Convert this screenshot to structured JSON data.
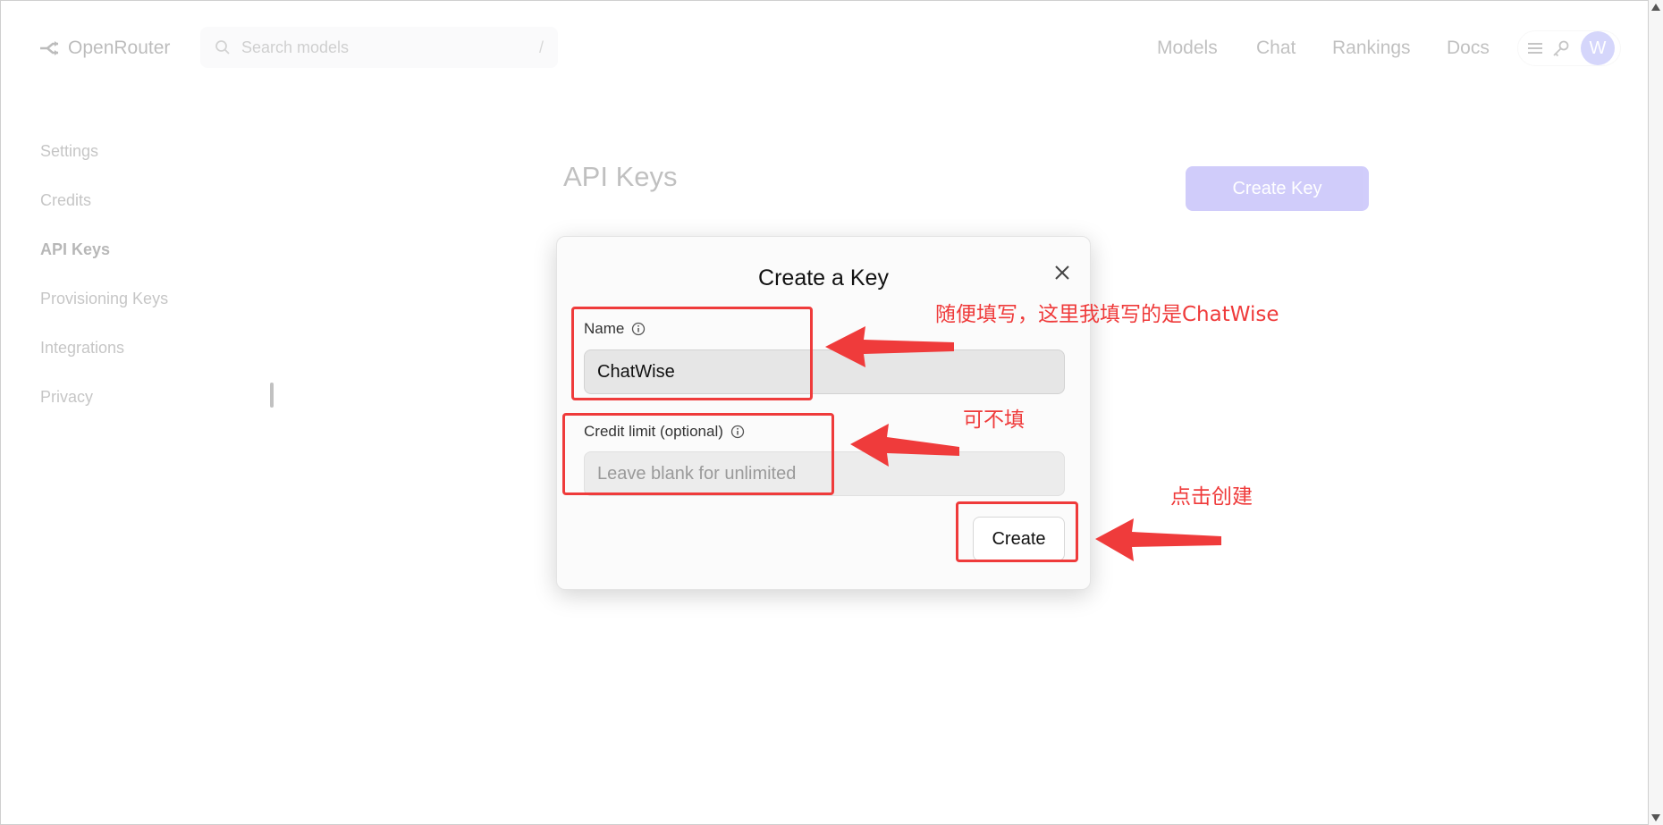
{
  "header": {
    "brand": "OpenRouter",
    "search_placeholder": "Search models",
    "search_shortcut": "/",
    "nav": [
      "Models",
      "Chat",
      "Rankings",
      "Docs"
    ],
    "avatar_initial": "W"
  },
  "sidebar": {
    "items": [
      {
        "label": "Settings",
        "active": false
      },
      {
        "label": "Credits",
        "active": false
      },
      {
        "label": "API Keys",
        "active": true
      },
      {
        "label": "Provisioning Keys",
        "active": false
      },
      {
        "label": "Integrations",
        "active": false
      },
      {
        "label": "Privacy",
        "active": false
      }
    ]
  },
  "main": {
    "title": "API Keys",
    "create_key_button": "Create Key"
  },
  "modal": {
    "title": "Create a Key",
    "name_label": "Name",
    "name_value": "ChatWise",
    "limit_label": "Credit limit (optional)",
    "limit_placeholder": "Leave blank for unlimited",
    "create_button": "Create"
  },
  "annotations": {
    "name_note": "随便填写，这里我填写的是ChatWise",
    "limit_note": "可不填",
    "create_note": "点击创建",
    "color": "#ef3b3b"
  }
}
